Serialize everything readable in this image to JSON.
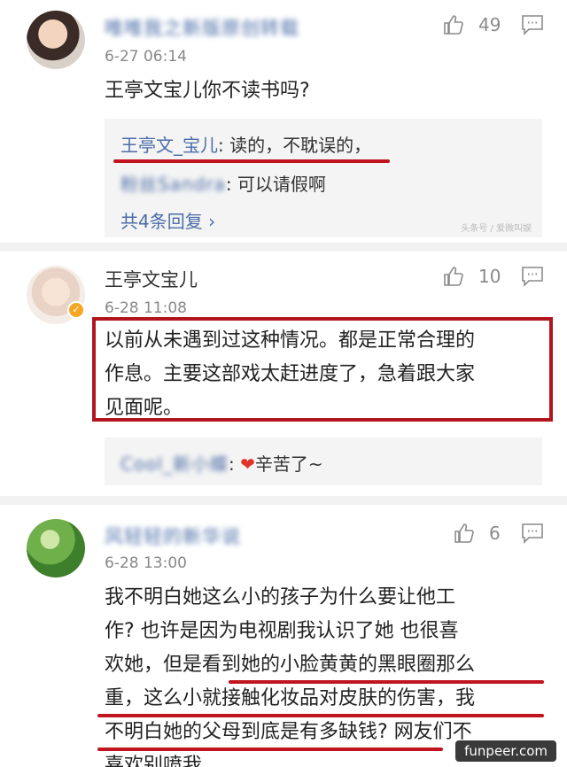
{
  "comment1": {
    "username": "唯唯我之新版原创转载",
    "time": "6-27 06:14",
    "likes": "49",
    "text": "王亭文宝儿你不读书吗?",
    "replies": [
      {
        "name": "王亭文_宝儿",
        "text": ": 读的，不耽误的，"
      },
      {
        "name": "粉丝Sandra",
        "text": ": 可以请假啊"
      }
    ],
    "more": "共4条回复 ›",
    "watermark": "头条号 / 爱微叫娱"
  },
  "comment2": {
    "username": "王亭文宝儿",
    "time": "6-28 11:08",
    "likes": "10",
    "text_lines": [
      "以前从未遇到过这种情况。都是正常合理的",
      "作息。主要这部戏太赶进度了，急着跟大家",
      "见面呢。"
    ],
    "reply": {
      "name": "Cool_新小蝶",
      "heart": "❤",
      "text": "辛苦了~"
    }
  },
  "comment3": {
    "username": "风轻轻的新华说",
    "time": "6-28 13:00",
    "likes": "6",
    "text_lines": [
      "我不明白她这么小的孩子为什么要让他工",
      "作? 也许是因为电视剧我认识了她 也很喜",
      "欢她，但是看到她的小脸黄黄的黑眼圈那么",
      "重，这么小就接触化妆品对皮肤的伤害，我",
      "不明白她的父母到底是有多缺钱? 网友们不",
      "喜欢别喷我"
    ]
  },
  "footer": {
    "site": "funpeer.com"
  },
  "colors": {
    "accent_red": "#c0141e",
    "link_blue": "#4a6da8",
    "badge_orange": "#f6a623"
  }
}
